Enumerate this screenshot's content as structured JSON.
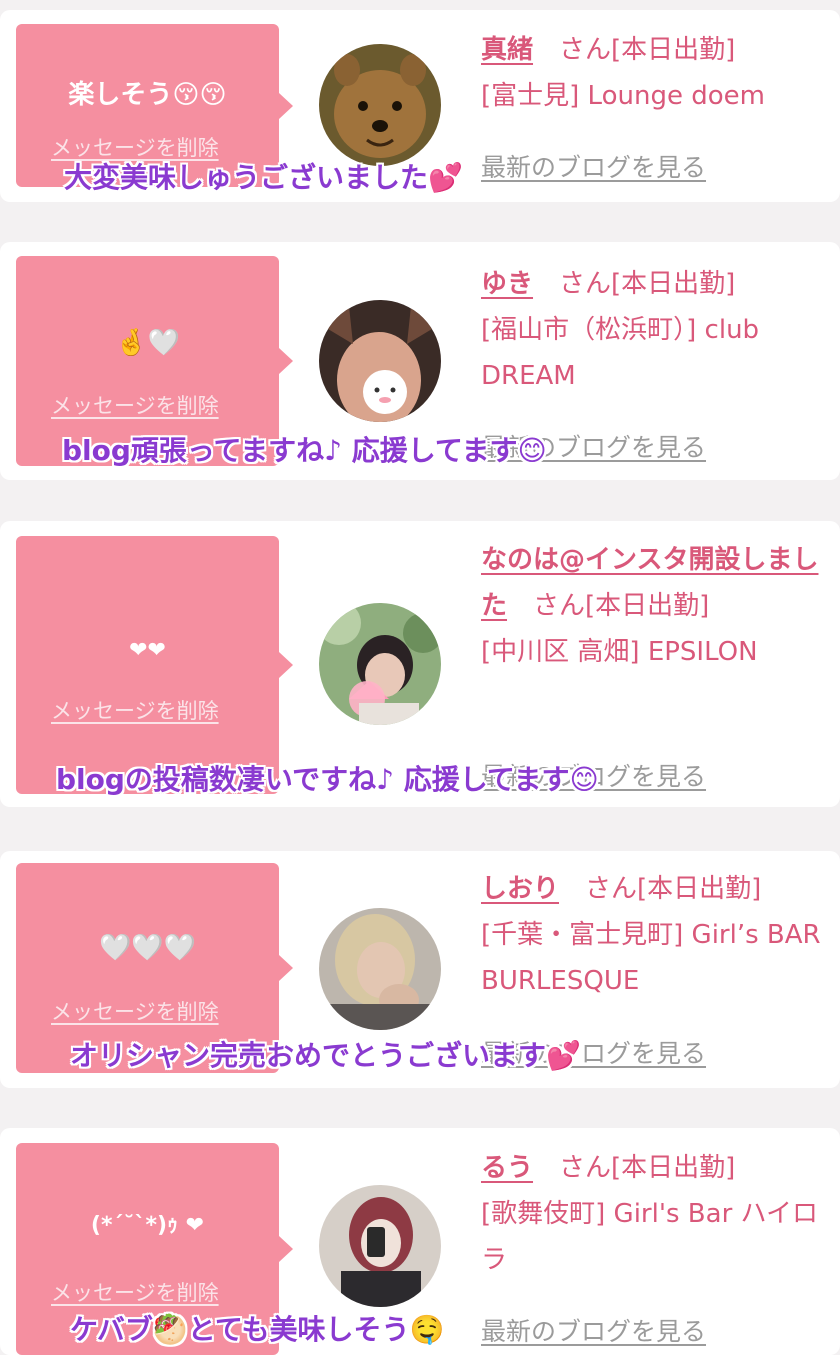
{
  "cards": [
    {
      "message": "楽しそう😚😚",
      "delete_label": "メッセージを削除",
      "name": "真緒",
      "honorific": "さん",
      "status": "[本日出勤]",
      "location_shop": "[富士見] Lounge doem",
      "blog_link": "最新のブログを見る",
      "overlay_comment": "大変美味しゅうございました💕"
    },
    {
      "message": "🤞🤍",
      "delete_label": "メッセージを削除",
      "name": "ゆき",
      "honorific": "さん",
      "status": "[本日出勤]",
      "location_shop": "[福山市（松浜町）] club DREAM",
      "blog_link": "最新のブログを見る",
      "overlay_comment": "blog頑張ってますね♪ 応援してます😊"
    },
    {
      "message": "❤❤",
      "delete_label": "メッセージを削除",
      "name": "なのは@インスタ開設しました",
      "honorific": "さん",
      "status": "[本日出勤]",
      "location_shop": "[中川区 高畑] EPSILON",
      "blog_link": "最新のブログを見る",
      "overlay_comment": "blogの投稿数凄いですね♪ 応援してます😊"
    },
    {
      "message": "🤍🤍🤍",
      "delete_label": "メッセージを削除",
      "name": "しおり",
      "honorific": "さん",
      "status": "[本日出勤]",
      "location_shop": "[千葉・富士見町] Girl’s BAR BURLESQUE",
      "blog_link": "最新のブログを見る",
      "overlay_comment": "オリシャン完売おめでとうございます💕"
    },
    {
      "message": "(*´˘`*)ｩ ❤",
      "delete_label": "メッセージを削除",
      "name": "るう",
      "honorific": "さん",
      "status": "[本日出勤]",
      "location_shop": "[歌舞伎町] Girl's Bar ハイロラ",
      "blog_link": "最新のブログを見る",
      "overlay_comment": "ケバブ🥙とても美味しそう🤤"
    }
  ],
  "colors": {
    "bubble": "#f58fa0",
    "name_link": "#d9587a",
    "overlay_text": "#8a3ad0",
    "background": "#f3f1f2"
  }
}
